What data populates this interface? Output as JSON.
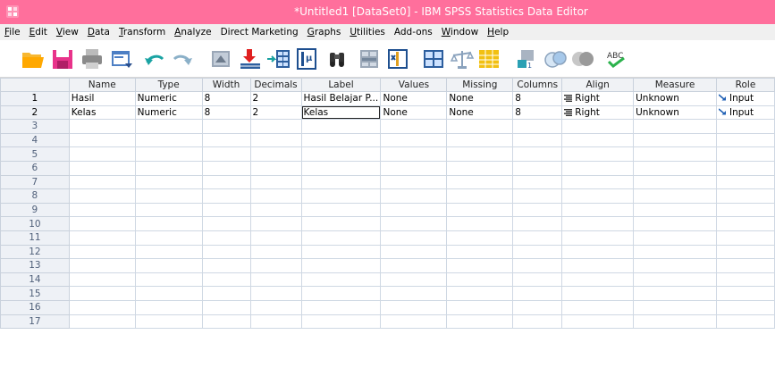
{
  "window": {
    "title": "*Untitled1 [DataSet0] - IBM SPSS Statistics Data Editor",
    "titlebar_color": "#ff6f9c"
  },
  "menu": {
    "items": [
      {
        "label": "File",
        "underline": "F",
        "rest": "ile"
      },
      {
        "label": "Edit",
        "underline": "E",
        "rest": "dit"
      },
      {
        "label": "View",
        "underline": "V",
        "rest": "iew"
      },
      {
        "label": "Data",
        "underline": "D",
        "rest": "ata"
      },
      {
        "label": "Transform",
        "underline": "T",
        "rest": "ransform"
      },
      {
        "label": "Analyze",
        "underline": "A",
        "rest": "nalyze"
      },
      {
        "label": "Direct Marketing",
        "underline": "",
        "rest": "Direct Marketing"
      },
      {
        "label": "Graphs",
        "underline": "G",
        "rest": "raphs"
      },
      {
        "label": "Utilities",
        "underline": "U",
        "rest": "tilities"
      },
      {
        "label": "Add-ons",
        "underline": "",
        "rest": "Add-ons"
      },
      {
        "label": "Window",
        "underline": "W",
        "rest": "indow"
      },
      {
        "label": "Help",
        "underline": "H",
        "rest": "elp"
      }
    ]
  },
  "toolbar": {
    "icons": [
      "open-folder-icon",
      "save-icon",
      "print-icon",
      "dialog-recall-icon",
      "undo-icon",
      "redo-icon",
      "goto-case-icon",
      "goto-variable-icon",
      "variables-icon",
      "run-descriptives-icon",
      "find-icon",
      "insert-cases-icon",
      "insert-variable-icon",
      "split-file-icon",
      "weight-cases-icon",
      "select-cases-icon",
      "value-labels-icon",
      "use-sets-icon",
      "show-all-variables-icon",
      "spell-check-icon"
    ],
    "spell_label": "ABC"
  },
  "grid": {
    "columns": [
      "Name",
      "Type",
      "Width",
      "Decimals",
      "Label",
      "Values",
      "Missing",
      "Columns",
      "Align",
      "Measure",
      "Role"
    ],
    "rows": [
      {
        "num": "1",
        "cells": [
          "Hasil",
          "Numeric",
          "8",
          "2",
          "Hasil Belajar  P...",
          "None",
          "None",
          "8",
          "Right",
          "Unknown",
          "Input"
        ]
      },
      {
        "num": "2",
        "cells": [
          "Kelas",
          "Numeric",
          "8",
          "2",
          "Kelas",
          "None",
          "None",
          "8",
          "Right",
          "Unknown",
          "Input"
        ]
      }
    ],
    "empty_row_numbers": [
      "3",
      "4",
      "5",
      "6",
      "7",
      "8",
      "9",
      "10",
      "11",
      "12",
      "13",
      "14",
      "15",
      "16",
      "17"
    ],
    "active_cell": {
      "row": 2,
      "column": "Label"
    }
  }
}
